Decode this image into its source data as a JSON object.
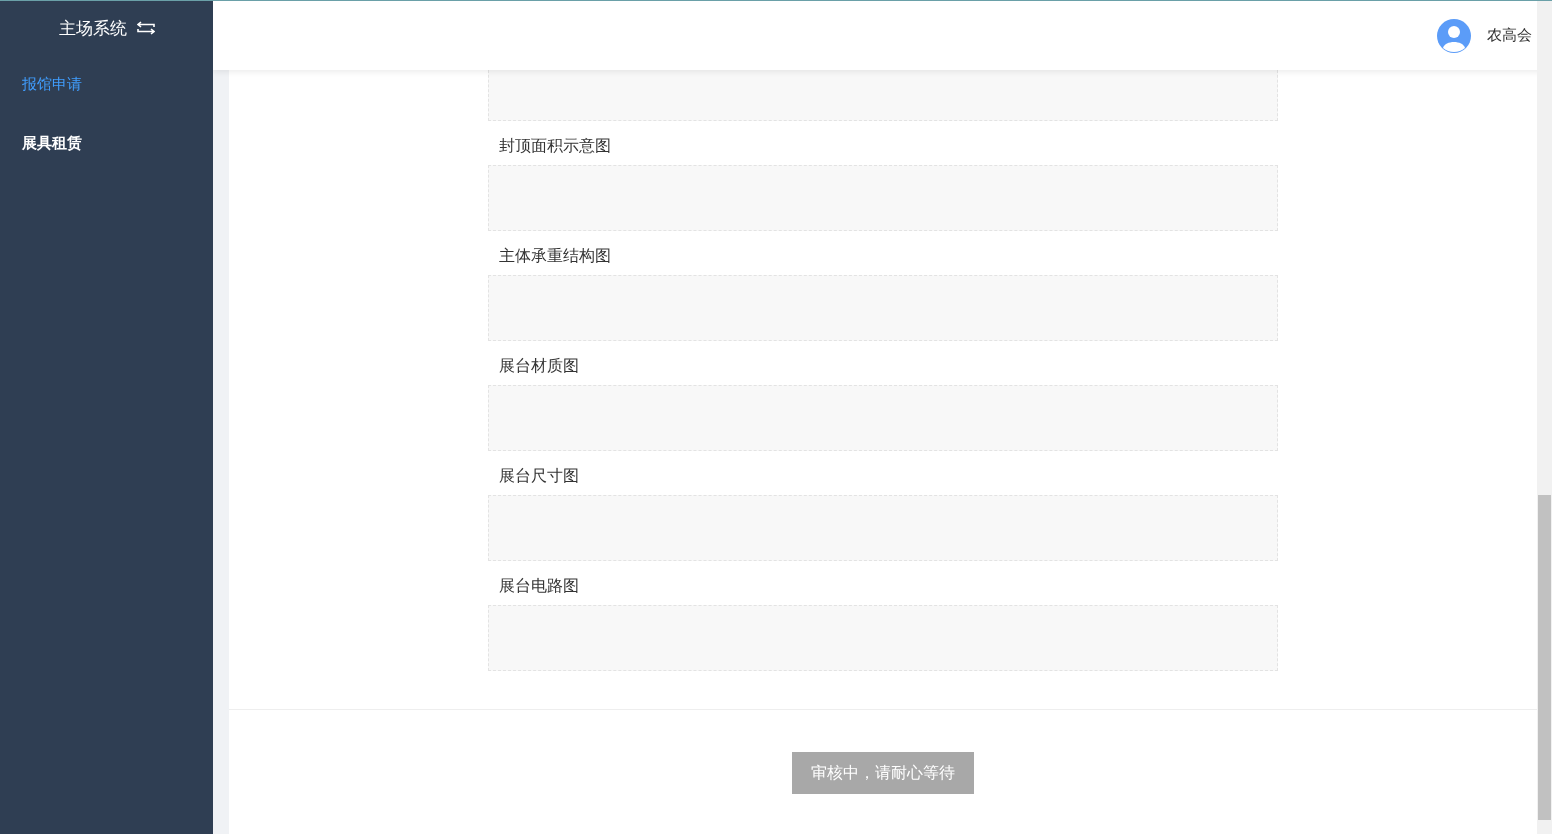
{
  "sidebar": {
    "title": "主场系统",
    "items": [
      {
        "label": "报馆申请",
        "selected": true
      },
      {
        "label": "展具租赁",
        "selected": false
      }
    ]
  },
  "header": {
    "user": "农高会"
  },
  "form": {
    "fields": [
      {
        "label": "封顶面积示意图"
      },
      {
        "label": "主体承重结构图"
      },
      {
        "label": "展台材质图"
      },
      {
        "label": "展台尺寸图"
      },
      {
        "label": "展台电路图"
      }
    ],
    "submit": {
      "label": "审核中，请耐心等待",
      "disabled": true
    }
  }
}
